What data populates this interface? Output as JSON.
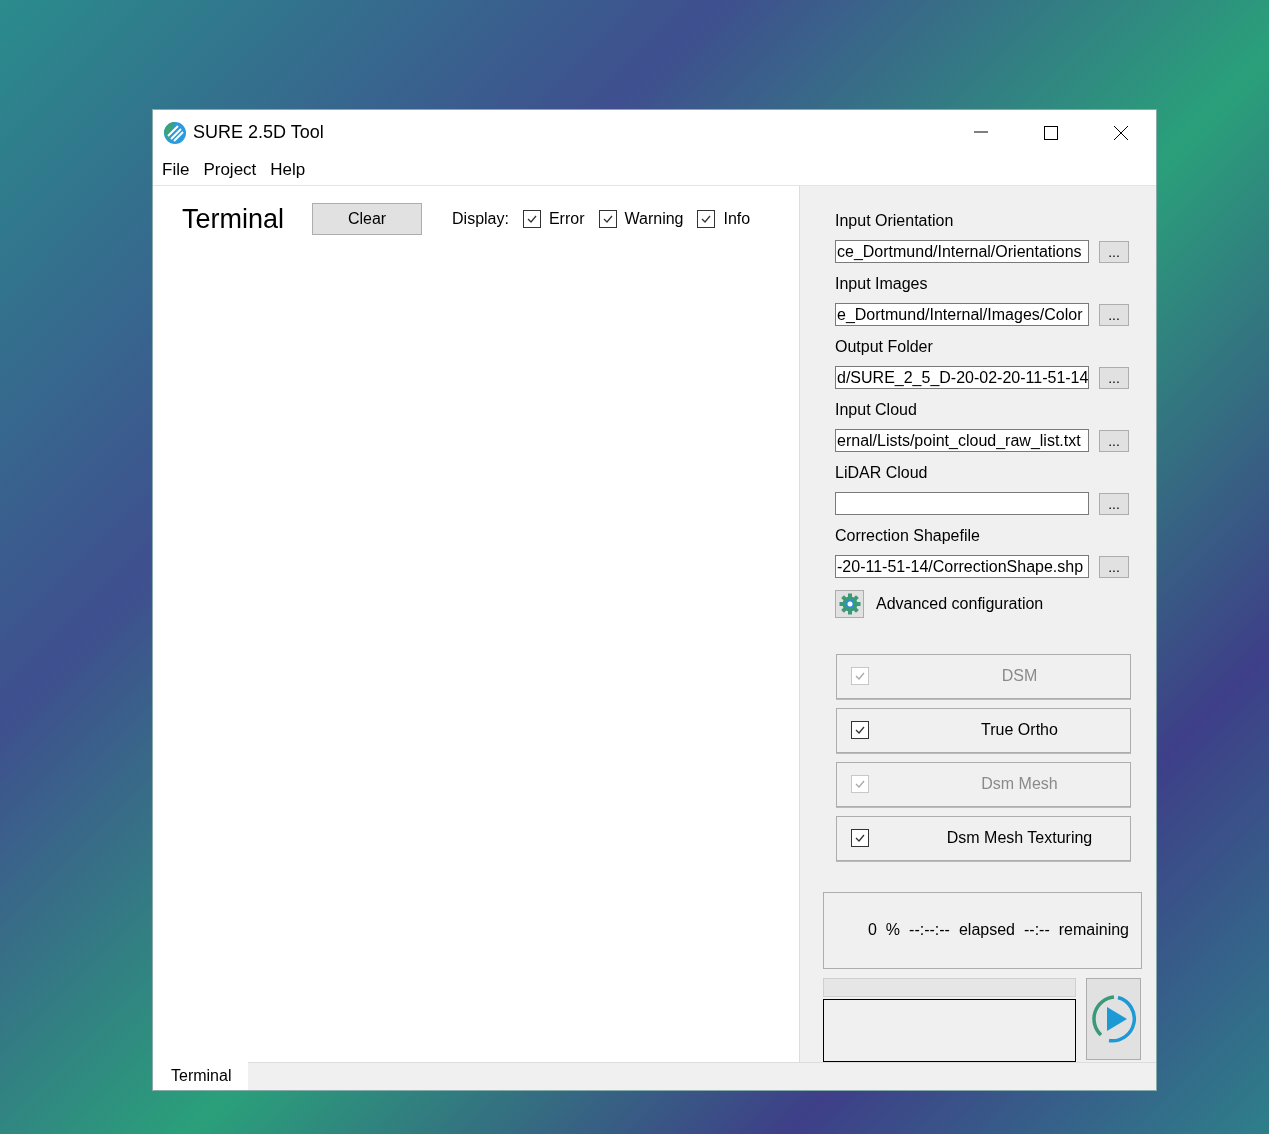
{
  "window": {
    "title": "SURE 2.5D Tool"
  },
  "menu": [
    "File",
    "Project",
    "Help"
  ],
  "terminal": {
    "title": "Terminal",
    "clear_button": "Clear",
    "display_label": "Display:",
    "filters": [
      {
        "label": "Error",
        "checked": true
      },
      {
        "label": "Warning",
        "checked": true
      },
      {
        "label": "Info",
        "checked": true
      }
    ]
  },
  "inputs": [
    {
      "label": "Input Orientation",
      "value": "ce_Dortmund/Internal/Orientations",
      "browse": "..."
    },
    {
      "label": "Input Images",
      "value": "e_Dortmund/Internal/Images/Color",
      "browse": "..."
    },
    {
      "label": "Output Folder",
      "value": "d/SURE_2_5_D-20-02-20-11-51-14",
      "browse": "..."
    },
    {
      "label": "Input Cloud",
      "value": "ernal/Lists/point_cloud_raw_list.txt",
      "browse": "..."
    },
    {
      "label": "LiDAR Cloud",
      "browse": "..."
    },
    {
      "label": "Correction Shapefile",
      "value": "-20-11-51-14/CorrectionShape.shp",
      "browse": "..."
    }
  ],
  "advanced": {
    "label": "Advanced configuration"
  },
  "tasks": [
    {
      "label": "DSM",
      "checked": true,
      "disabled": true
    },
    {
      "label": "True Ortho",
      "checked": true,
      "disabled": false
    },
    {
      "label": "Dsm Mesh",
      "checked": true,
      "disabled": true
    },
    {
      "label": "Dsm Mesh Texturing",
      "checked": true,
      "disabled": false
    }
  ],
  "status": {
    "percent": "0",
    "percent_sign": "%",
    "elapsed": "--:--:--",
    "elapsed_label": "elapsed",
    "remaining": "--:--",
    "remaining_label": "remaining"
  },
  "progress": {
    "level": 0
  },
  "bottom_tabs": [
    {
      "label": "Terminal",
      "selected": true
    }
  ]
}
